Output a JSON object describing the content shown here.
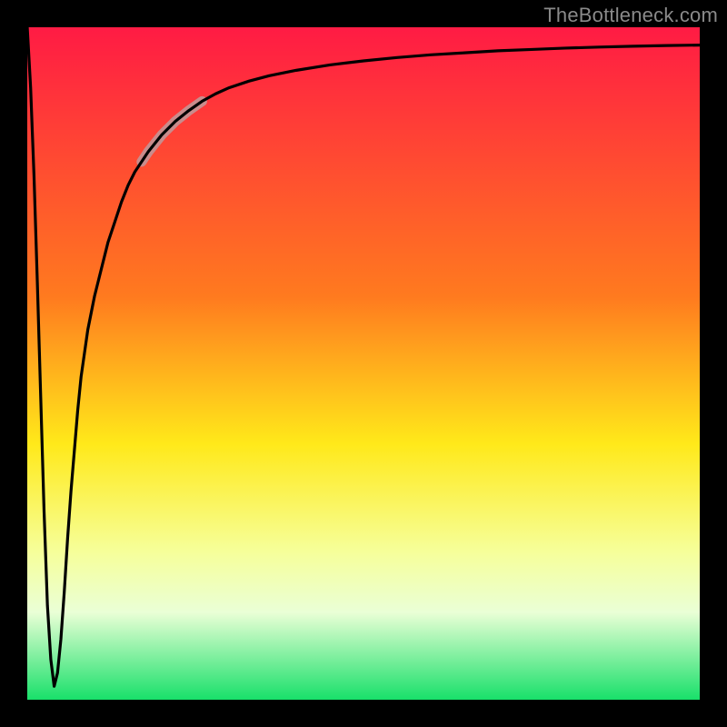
{
  "watermark": "TheBottleneck.com",
  "chart_data": {
    "type": "line",
    "title": "",
    "xlabel": "",
    "ylabel": "",
    "xlim": [
      0,
      100
    ],
    "ylim": [
      0,
      100
    ],
    "grid": false,
    "legend": false,
    "gradient_stops": [
      {
        "offset": 0,
        "color": "#ff1b44"
      },
      {
        "offset": 40,
        "color": "#ff7a1f"
      },
      {
        "offset": 62,
        "color": "#ffe91a"
      },
      {
        "offset": 78,
        "color": "#f6ff9a"
      },
      {
        "offset": 87,
        "color": "#eaffd6"
      },
      {
        "offset": 100,
        "color": "#18e06a"
      }
    ],
    "highlight_segment": {
      "x_start": 17,
      "x_end": 27
    },
    "series": [
      {
        "name": "curve",
        "x": [
          0,
          0.5,
          1,
          1.5,
          2,
          2.5,
          3,
          3.5,
          4,
          4.5,
          5,
          5.5,
          6,
          6.5,
          7,
          7.5,
          8,
          9,
          10,
          11,
          12,
          13,
          14,
          15,
          16,
          17,
          18,
          20,
          22,
          24,
          26,
          28,
          30,
          33,
          36,
          40,
          45,
          50,
          55,
          60,
          65,
          70,
          75,
          80,
          85,
          90,
          95,
          100
        ],
        "values": [
          100,
          91,
          78,
          62,
          45,
          28,
          14,
          6,
          2,
          4,
          9,
          16,
          24,
          31,
          37,
          43,
          48,
          55,
          60,
          64,
          68,
          71,
          74,
          76.5,
          78.5,
          80,
          81.5,
          84,
          86,
          87.6,
          89,
          90.1,
          91,
          92,
          92.8,
          93.6,
          94.4,
          95,
          95.5,
          95.9,
          96.2,
          96.5,
          96.7,
          96.9,
          97.05,
          97.18,
          97.28,
          97.35
        ]
      }
    ]
  }
}
